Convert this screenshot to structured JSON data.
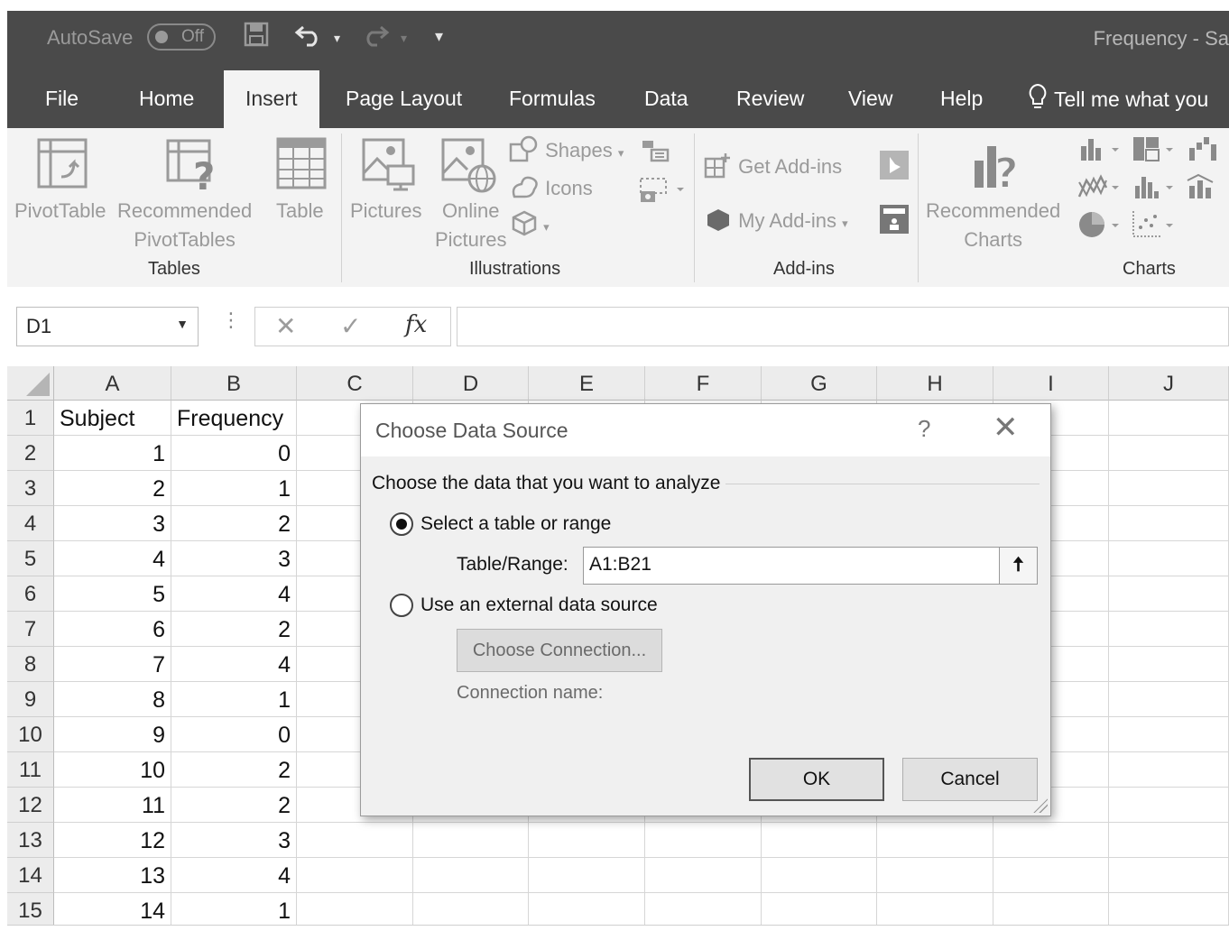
{
  "titlebar": {
    "autosave_label": "AutoSave",
    "autosave_state": "Off",
    "document_title": "Frequency  -  Sa"
  },
  "tabs": {
    "file": "File",
    "home": "Home",
    "insert": "Insert",
    "page_layout": "Page Layout",
    "formulas": "Formulas",
    "data": "Data",
    "review": "Review",
    "view": "View",
    "help": "Help",
    "tell_me": "Tell me what you"
  },
  "ribbon": {
    "tables": {
      "pivottable": "PivotTable",
      "recommended_line1": "Recommended",
      "recommended_line2": "PivotTables",
      "table": "Table",
      "group": "Tables"
    },
    "illustrations": {
      "pictures": "Pictures",
      "online_line1": "Online",
      "online_line2": "Pictures",
      "shapes": "Shapes",
      "icons": "Icons",
      "group": "Illustrations"
    },
    "addins": {
      "get_addins": "Get Add-ins",
      "my_addins": "My Add-ins",
      "group": "Add-ins"
    },
    "charts": {
      "recommended_line1": "Recommended",
      "recommended_line2": "Charts",
      "group": "Charts"
    }
  },
  "formula_bar": {
    "name_box": "D1",
    "formula": ""
  },
  "sheet": {
    "columns": [
      "A",
      "B",
      "C",
      "D",
      "E",
      "F",
      "G",
      "H",
      "I",
      "J"
    ],
    "rows": [
      {
        "n": "1",
        "a": "Subject",
        "b": "Frequency"
      },
      {
        "n": "2",
        "a": "1",
        "b": "0"
      },
      {
        "n": "3",
        "a": "2",
        "b": "1"
      },
      {
        "n": "4",
        "a": "3",
        "b": "2"
      },
      {
        "n": "5",
        "a": "4",
        "b": "3"
      },
      {
        "n": "6",
        "a": "5",
        "b": "4"
      },
      {
        "n": "7",
        "a": "6",
        "b": "2"
      },
      {
        "n": "8",
        "a": "7",
        "b": "4"
      },
      {
        "n": "9",
        "a": "8",
        "b": "1"
      },
      {
        "n": "10",
        "a": "9",
        "b": "0"
      },
      {
        "n": "11",
        "a": "10",
        "b": "2"
      },
      {
        "n": "12",
        "a": "11",
        "b": "2"
      },
      {
        "n": "13",
        "a": "12",
        "b": "3"
      },
      {
        "n": "14",
        "a": "13",
        "b": "4"
      },
      {
        "n": "15",
        "a": "14",
        "b": "1"
      }
    ]
  },
  "dialog": {
    "title": "Choose Data Source",
    "help": "?",
    "prompt": "Choose the data that you want to analyze",
    "option_table": "Select a table or range",
    "range_label": "Table/Range:",
    "range_value": "A1:B21",
    "option_external": "Use an external data source",
    "choose_connection": "Choose Connection...",
    "connection_name": "Connection name:",
    "ok": "OK",
    "cancel": "Cancel",
    "selected_option": "table"
  }
}
